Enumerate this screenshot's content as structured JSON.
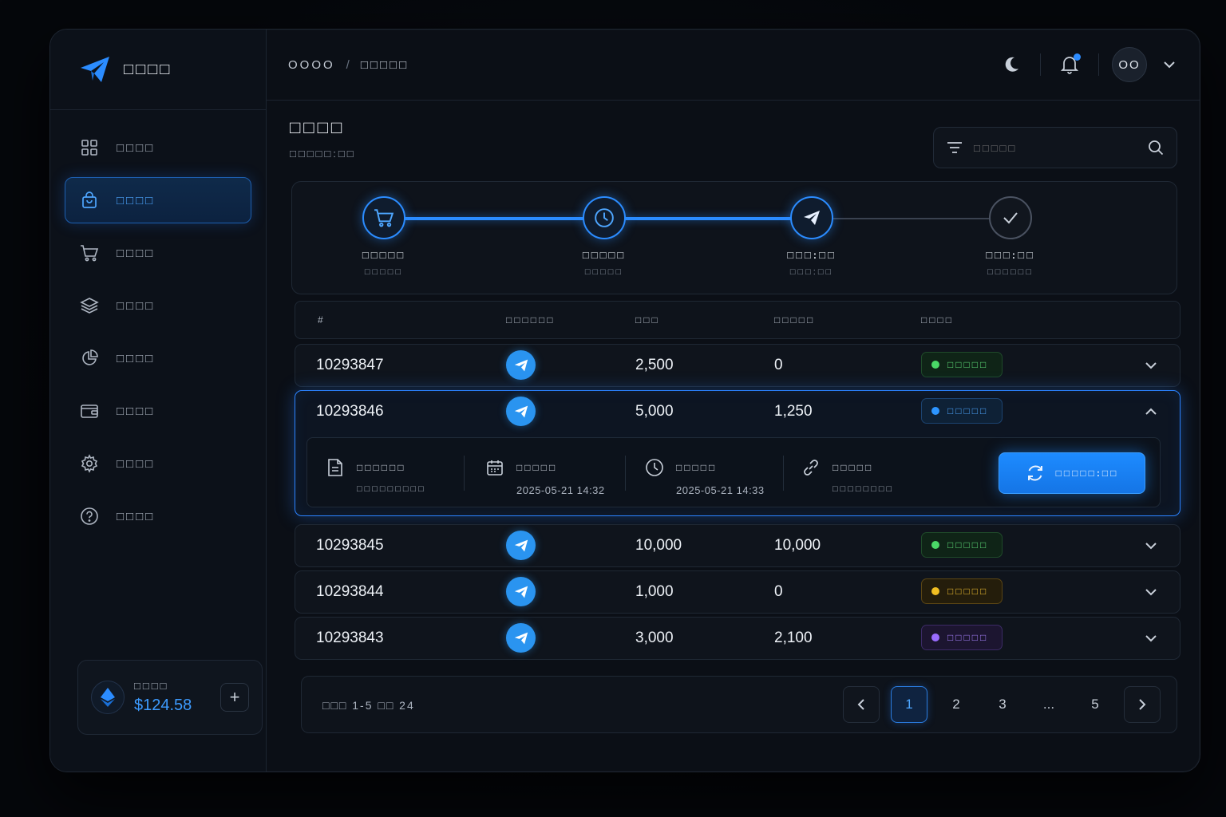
{
  "brand": {
    "name": "□□□□"
  },
  "sidebar": {
    "items": [
      {
        "label": "□□□□",
        "icon": "grid-icon"
      },
      {
        "label": "□□□□",
        "icon": "shopping-bag-icon"
      },
      {
        "label": "□□□□",
        "icon": "cart-icon"
      },
      {
        "label": "□□□□",
        "icon": "layers-icon"
      },
      {
        "label": "□□□□",
        "icon": "pie-chart-icon"
      },
      {
        "label": "□□□□",
        "icon": "wallet-icon"
      },
      {
        "label": "□□□□",
        "icon": "gear-icon"
      },
      {
        "label": "□□□□",
        "icon": "help-icon"
      }
    ],
    "wallet": {
      "label": "□□□□",
      "amount": "$124.58"
    }
  },
  "topbar": {
    "breadcrumb": [
      "OOOO",
      "□□□□□"
    ],
    "breadcrumb_sep": "/",
    "avatar": "OO"
  },
  "page": {
    "title": "□□□□",
    "subtitle": "□□□□□:□□",
    "search_placeholder": "□□□□□"
  },
  "stepper": [
    {
      "label": "□□□□□",
      "sub": "□□□□□",
      "state": "done",
      "icon": "cart-icon"
    },
    {
      "label": "□□□□□",
      "sub": "□□□□□",
      "state": "done",
      "icon": "clock-icon"
    },
    {
      "label": "□□□:□□",
      "sub": "□□□:□□",
      "state": "active",
      "icon": "send-icon"
    },
    {
      "label": "□□□:□□",
      "sub": "□□□□□□",
      "state": "pending",
      "icon": "check-icon"
    }
  ],
  "table": {
    "headers": [
      "#",
      "□□□□□□",
      "□□□",
      "□□□□□",
      "□□□□"
    ],
    "rows": [
      {
        "id": "10293847",
        "qty": "2,500",
        "delivered": "0",
        "status": "□□□□□",
        "status_color": "green"
      },
      {
        "id": "10293846",
        "qty": "5,000",
        "delivered": "1,250",
        "status": "□□□□□",
        "status_color": "blue"
      },
      {
        "id": "10293845",
        "qty": "10,000",
        "delivered": "10,000",
        "status": "□□□□□",
        "status_color": "green"
      },
      {
        "id": "10293844",
        "qty": "1,000",
        "delivered": "0",
        "status": "□□□□□",
        "status_color": "yellow"
      },
      {
        "id": "10293843",
        "qty": "3,000",
        "delivered": "2,100",
        "status": "□□□□□",
        "status_color": "purple"
      }
    ],
    "detail": {
      "order_label": "□□□□□□",
      "order_value": "□□□□□□□□□",
      "created_label": "□□□□□",
      "created_value": "2025-05-21 14:32",
      "updated_label": "□□□□□",
      "updated_value": "2025-05-21 14:33",
      "link_label": "□□□□□",
      "link_value": "□□□□□□□□",
      "retry_label": "□□□□□:□□"
    }
  },
  "pagination": {
    "info": "□□□ 1-5 □□ 24",
    "pages": [
      "1",
      "2",
      "3",
      "...",
      "5"
    ],
    "current": "1"
  },
  "colors": {
    "accent": "#2b8cff",
    "telegram": "#2a94f0",
    "green": "#4ad867",
    "yellow": "#f0be22",
    "purple": "#9a6cff"
  }
}
